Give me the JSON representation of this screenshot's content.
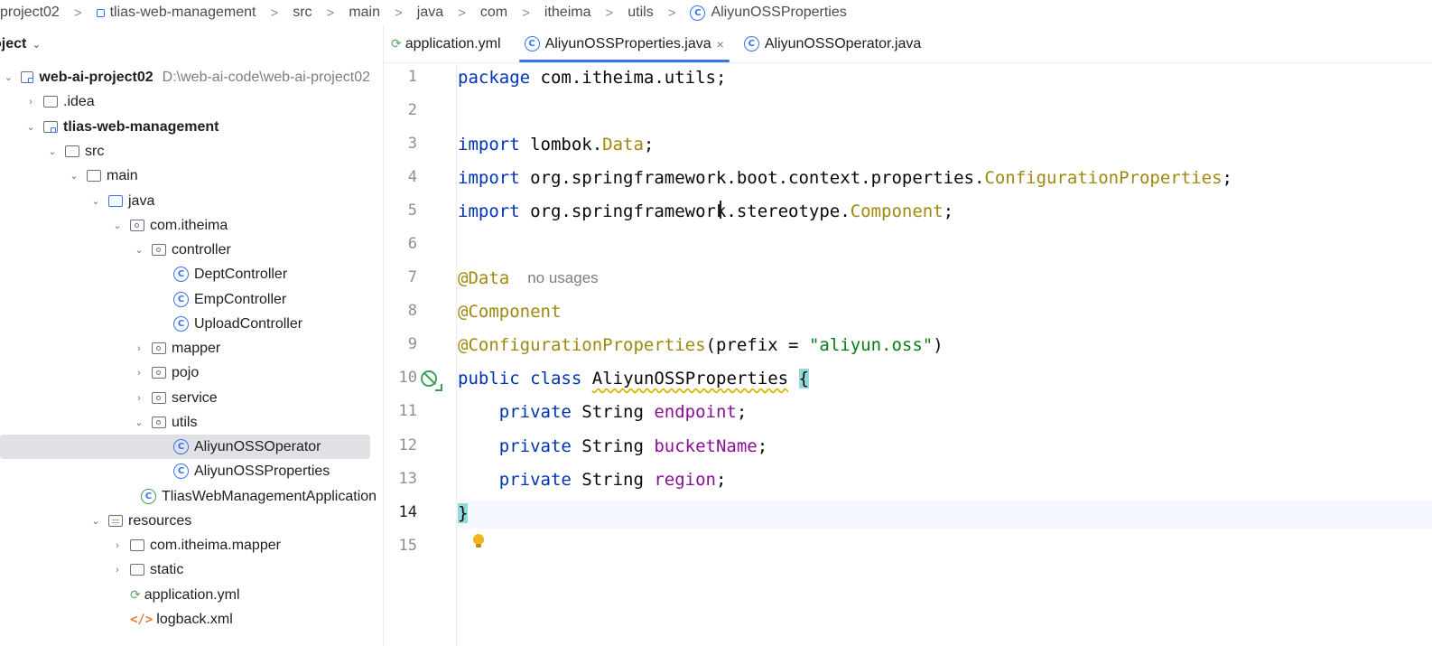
{
  "breadcrumb": [
    {
      "label": "project02",
      "icon": "none"
    },
    {
      "label": "tlias-web-management",
      "icon": "module-icon"
    },
    {
      "label": "src",
      "icon": "none"
    },
    {
      "label": "main",
      "icon": "none"
    },
    {
      "label": "java",
      "icon": "none"
    },
    {
      "label": "com",
      "icon": "none"
    },
    {
      "label": "itheima",
      "icon": "none"
    },
    {
      "label": "utils",
      "icon": "none"
    },
    {
      "label": "AliyunOSSProperties",
      "icon": "class-icon"
    }
  ],
  "breadcrumb_separator": ">",
  "project_panel": {
    "title": "oject",
    "chevron": "⌄"
  },
  "tree": [
    {
      "label": "web-ai-project02",
      "hint": "D:\\web-ai-code\\web-ai-project02",
      "arrow": "⌄",
      "icon": "module-folder-icon",
      "bold": true,
      "indent": 0,
      "selected": false
    },
    {
      "label": ".idea",
      "arrow": "›",
      "icon": "folder-icon",
      "indent": 1,
      "selected": false
    },
    {
      "label": "tlias-web-management",
      "arrow": "⌄",
      "icon": "module-folder-icon",
      "bold": true,
      "indent": 1,
      "selected": false
    },
    {
      "label": "src",
      "arrow": "⌄",
      "icon": "folder-icon",
      "indent": 2,
      "selected": false
    },
    {
      "label": "main",
      "arrow": "⌄",
      "icon": "folder-icon",
      "indent": 3,
      "selected": false
    },
    {
      "label": "java",
      "arrow": "⌄",
      "icon": "source-folder-icon",
      "indent": 4,
      "selected": false
    },
    {
      "label": "com.itheima",
      "arrow": "⌄",
      "icon": "package-icon",
      "indent": 5,
      "selected": false
    },
    {
      "label": "controller",
      "arrow": "⌄",
      "icon": "package-icon",
      "indent": 6,
      "selected": false
    },
    {
      "label": "DeptController",
      "arrow": "",
      "icon": "class-icon",
      "indent": 7,
      "selected": false
    },
    {
      "label": "EmpController",
      "arrow": "",
      "icon": "class-icon",
      "indent": 7,
      "selected": false
    },
    {
      "label": "UploadController",
      "arrow": "",
      "icon": "class-icon",
      "indent": 7,
      "selected": false
    },
    {
      "label": "mapper",
      "arrow": "›",
      "icon": "package-icon",
      "indent": 6,
      "selected": false
    },
    {
      "label": "pojo",
      "arrow": "›",
      "icon": "package-icon",
      "indent": 6,
      "selected": false
    },
    {
      "label": "service",
      "arrow": "›",
      "icon": "package-icon",
      "indent": 6,
      "selected": false
    },
    {
      "label": "utils",
      "arrow": "⌄",
      "icon": "package-icon",
      "indent": 6,
      "selected": false
    },
    {
      "label": "AliyunOSSOperator",
      "arrow": "",
      "icon": "class-icon",
      "indent": 7,
      "selected": true
    },
    {
      "label": "AliyunOSSProperties",
      "arrow": "",
      "icon": "class-icon",
      "indent": 7,
      "selected": false
    },
    {
      "label": "TliasWebManagementApplication",
      "arrow": "",
      "icon": "spring-boot-class-icon",
      "indent": 6,
      "selected": false
    },
    {
      "label": "resources",
      "arrow": "⌄",
      "icon": "resources-folder-icon",
      "indent": 4,
      "selected": false
    },
    {
      "label": "com.itheima.mapper",
      "arrow": "›",
      "icon": "folder-icon",
      "indent": 5,
      "selected": false
    },
    {
      "label": "static",
      "arrow": "›",
      "icon": "folder-icon",
      "indent": 5,
      "selected": false
    },
    {
      "label": "application.yml",
      "arrow": "",
      "icon": "yaml-file-icon",
      "indent": 5,
      "selected": false
    },
    {
      "label": "logback.xml",
      "arrow": "",
      "icon": "xml-file-icon",
      "indent": 5,
      "selected": false
    }
  ],
  "tabs": [
    {
      "label": "application.yml",
      "icon": "yaml-file-icon",
      "active": false,
      "close": ""
    },
    {
      "label": "AliyunOSSProperties.java",
      "icon": "class-icon",
      "active": true,
      "close": "×"
    },
    {
      "label": "AliyunOSSOperator.java",
      "icon": "class-icon",
      "active": false,
      "close": ""
    }
  ],
  "line_numbers": [
    "1",
    "2",
    "3",
    "4",
    "5",
    "6",
    "7",
    "8",
    "9",
    "10",
    "11",
    "12",
    "13",
    "14",
    "15"
  ],
  "current_line": "14",
  "code_lines": [
    [
      {
        "t": "package",
        "c": "kw"
      },
      {
        "t": " com.itheima.utils;",
        "c": ""
      }
    ],
    [],
    [
      {
        "t": "import",
        "c": "kw"
      },
      {
        "t": " lombok.",
        "c": ""
      },
      {
        "t": "Data",
        "c": "cls"
      },
      {
        "t": ";",
        "c": ""
      }
    ],
    [
      {
        "t": "import",
        "c": "kw"
      },
      {
        "t": " org.springframework.boot.context.properties.",
        "c": ""
      },
      {
        "t": "ConfigurationProperties",
        "c": "cls"
      },
      {
        "t": ";",
        "c": ""
      }
    ],
    [
      {
        "t": "import",
        "c": "kw"
      },
      {
        "t": " org.springframework.stereotype.",
        "c": ""
      },
      {
        "t": "Component",
        "c": "cls"
      },
      {
        "t": ";",
        "c": ""
      }
    ],
    [],
    [
      {
        "t": "@Data",
        "c": "ann"
      },
      {
        "t": "no usages",
        "c": "hint"
      }
    ],
    [
      {
        "t": "@Component",
        "c": "ann"
      }
    ],
    [
      {
        "t": "@ConfigurationProperties",
        "c": "ann"
      },
      {
        "t": "(prefix = ",
        "c": ""
      },
      {
        "t": "\"aliyun.oss\"",
        "c": "str"
      },
      {
        "t": ")",
        "c": ""
      }
    ],
    [
      {
        "t": "public",
        "c": "kw"
      },
      {
        "t": " ",
        "c": ""
      },
      {
        "t": "class",
        "c": "kw"
      },
      {
        "t": " ",
        "c": ""
      },
      {
        "t": "AliyunOSSProperties",
        "c": "squig"
      },
      {
        "t": " ",
        "c": ""
      },
      {
        "t": "{",
        "c": "brace-hl"
      }
    ],
    [
      {
        "t": "    ",
        "c": ""
      },
      {
        "t": "private",
        "c": "kw"
      },
      {
        "t": " String ",
        "c": ""
      },
      {
        "t": "endpoint",
        "c": "field"
      },
      {
        "t": ";",
        "c": ""
      }
    ],
    [
      {
        "t": "    ",
        "c": ""
      },
      {
        "t": "private",
        "c": "kw"
      },
      {
        "t": " String ",
        "c": ""
      },
      {
        "t": "bucketName",
        "c": "field"
      },
      {
        "t": ";",
        "c": ""
      }
    ],
    [
      {
        "t": "    ",
        "c": ""
      },
      {
        "t": "private",
        "c": "kw"
      },
      {
        "t": " String ",
        "c": ""
      },
      {
        "t": "region",
        "c": "field"
      },
      {
        "t": ";",
        "c": ""
      }
    ],
    [
      {
        "t": "}",
        "c": "brace-hl"
      }
    ],
    []
  ],
  "colors": {
    "accent": "#3574f0",
    "keyword": "#0033b3",
    "annotation": "#9e880d",
    "string": "#067d17",
    "field": "#871094",
    "brace_highlight": "#93d9d9"
  }
}
